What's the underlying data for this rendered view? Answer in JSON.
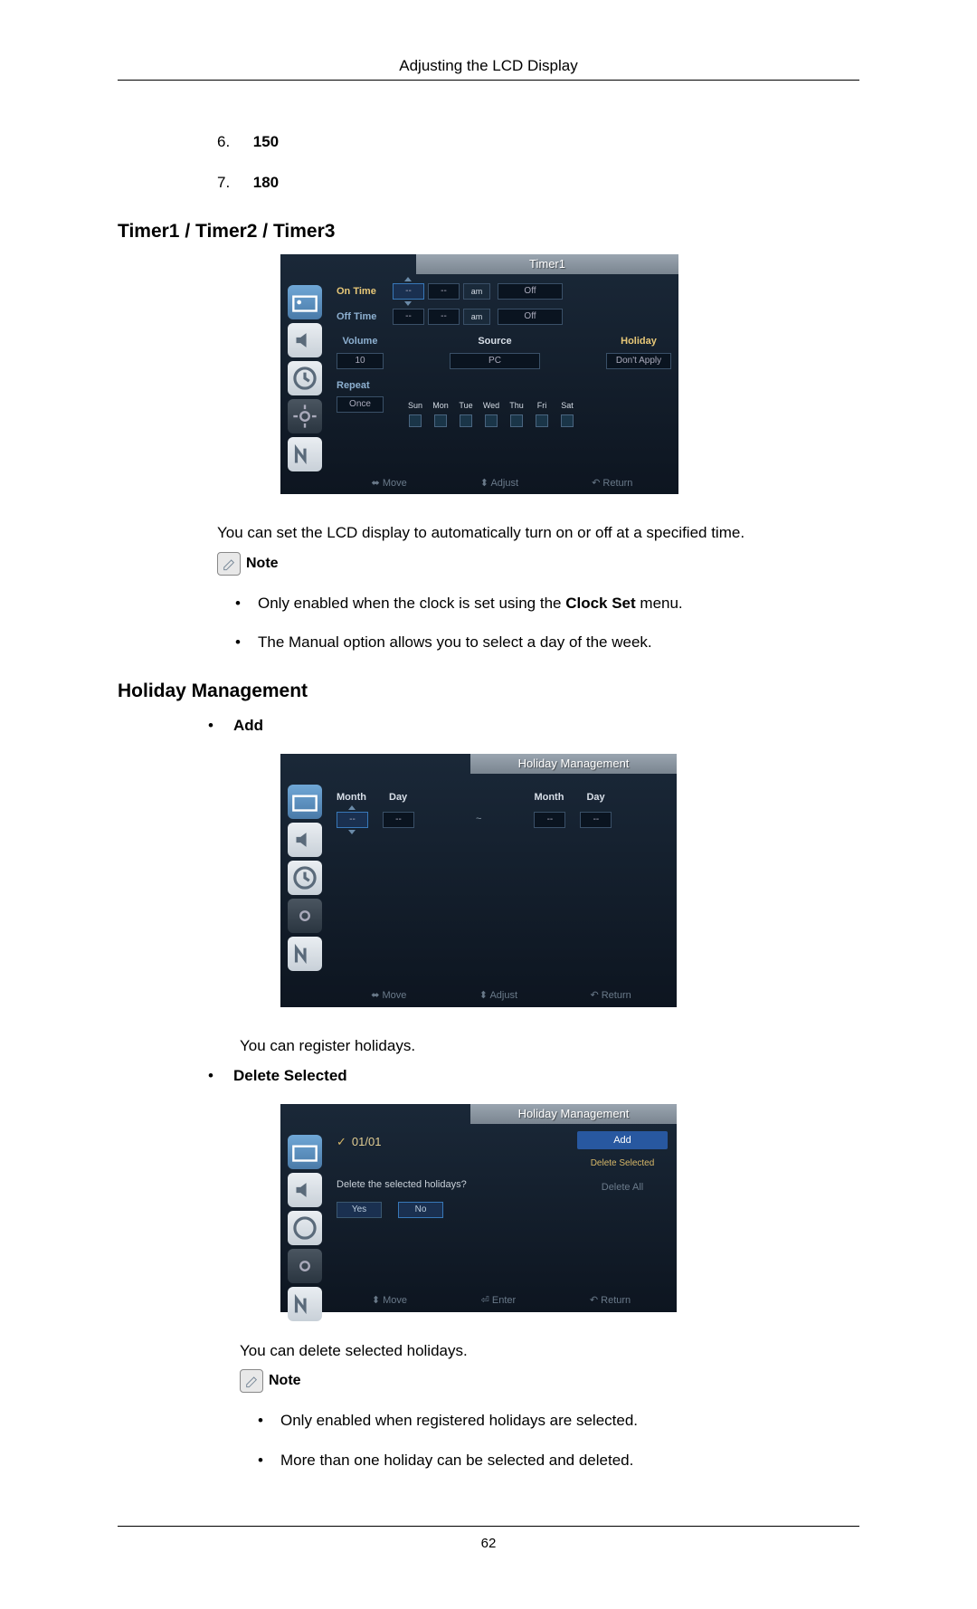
{
  "header": "Adjusting the LCD Display",
  "continued_list": [
    {
      "num": "6.",
      "val": "150"
    },
    {
      "num": "7.",
      "val": "180"
    }
  ],
  "timer": {
    "title": "Timer1 / Timer2 / Timer3",
    "osd_title": "Timer1",
    "on_time_label": "On Time",
    "off_time_label": "Off Time",
    "dash": "--",
    "am": "am",
    "off": "Off",
    "volume_label": "Volume",
    "volume_val": "10",
    "source_label": "Source",
    "source_val": "PC",
    "holiday_label": "Holiday",
    "holiday_val": "Don't Apply",
    "repeat_label": "Repeat",
    "repeat_val": "Once",
    "days": [
      "Sun",
      "Mon",
      "Tue",
      "Wed",
      "Thu",
      "Fri",
      "Sat"
    ],
    "footer_move": "Move",
    "footer_adjust": "Adjust",
    "footer_return": "Return",
    "desc": "You can set the LCD display to automatically turn on or off at a specified time.",
    "note_label": "Note",
    "notes": [
      {
        "pre": "Only enabled when the clock is set using the ",
        "bold": "Clock Set",
        "post": " menu."
      },
      {
        "pre": "The Manual option allows you to select a day of the week.",
        "bold": "",
        "post": ""
      }
    ]
  },
  "holiday": {
    "title": "Holiday Management",
    "add_label": "Add",
    "osd_title": "Holiday Management",
    "month_label": "Month",
    "day_label": "Day",
    "dash": "--",
    "tilde": "~",
    "footer_move": "Move",
    "footer_adjust": "Adjust",
    "footer_return": "Return",
    "desc": "You can register holidays.",
    "delete_label": "Delete Selected",
    "date_example": "01/01",
    "prompt": "Delete the selected holidays?",
    "yes": "Yes",
    "no": "No",
    "add_btn": "Add",
    "del_sel_btn": "Delete Selected",
    "del_all_btn": "Delete All",
    "footer_enter": "Enter",
    "desc2": "You can delete selected holidays.",
    "note_label": "Note",
    "notes": [
      "Only enabled when registered holidays are selected.",
      "More than one holiday can be selected and deleted."
    ]
  },
  "page_num": "62"
}
